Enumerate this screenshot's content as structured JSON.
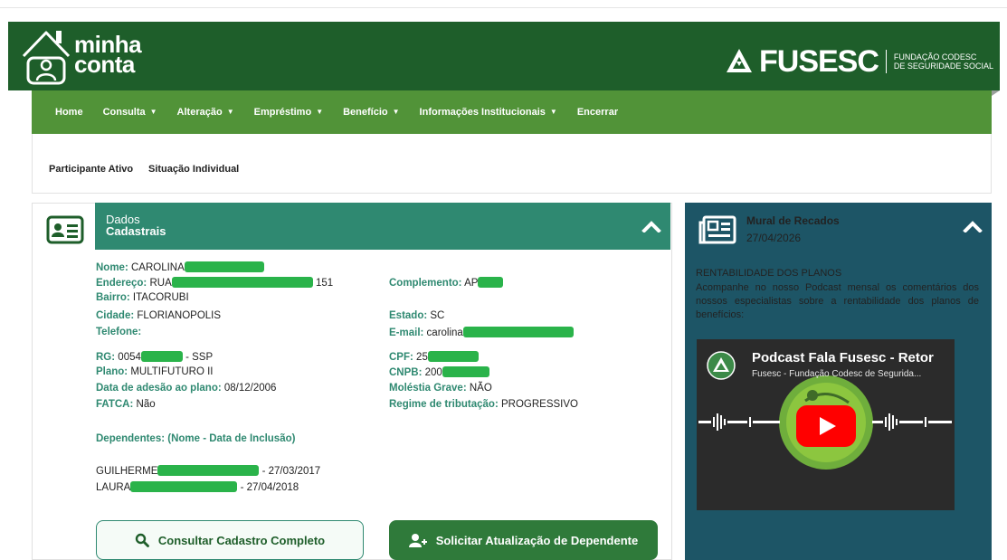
{
  "header": {
    "logo_line1": "minha",
    "logo_line2": "conta",
    "brand_name": "FUSESC",
    "brand_sub1": "FUNDAÇÃO CODESC",
    "brand_sub2": "DE SEGURIDADE SOCIAL"
  },
  "nav": {
    "items": [
      {
        "label": "Home",
        "dropdown": false
      },
      {
        "label": "Consulta",
        "dropdown": true
      },
      {
        "label": "Alteração",
        "dropdown": true
      },
      {
        "label": "Empréstimo",
        "dropdown": true
      },
      {
        "label": "Benefício",
        "dropdown": true
      },
      {
        "label": "Informações Institucionais",
        "dropdown": true
      },
      {
        "label": "Encerrar",
        "dropdown": false
      }
    ],
    "caret": "▼"
  },
  "subnav": {
    "status": "Participante Ativo",
    "situacao": "Situação Individual"
  },
  "dados": {
    "title1": "Dados",
    "title2": "Cadastrais",
    "nome_lbl": "Nome:",
    "nome_val": "CAROLINA",
    "endereco_lbl": "Endereço:",
    "endereco_val": "RUA",
    "endereco_num": "151",
    "complemento_lbl": "Complemento:",
    "complemento_val": "AP",
    "bairro_lbl": "Bairro:",
    "bairro_val": "ITACORUBI",
    "cidade_lbl": "Cidade:",
    "cidade_val": "FLORIANOPOLIS",
    "estado_lbl": "Estado:",
    "estado_val": "SC",
    "telefone_lbl": "Telefone:",
    "email_lbl": "E-mail:",
    "email_val": "carolina",
    "rg_lbl": "RG:",
    "rg_val": "0054",
    "rg_suffix": "- SSP",
    "cpf_lbl": "CPF:",
    "cpf_val": "25",
    "plano_lbl": "Plano:",
    "plano_val": "MULTIFUTURO II",
    "cnpb_lbl": "CNPB:",
    "cnpb_val": "200",
    "adesao_lbl": "Data de adesão ao plano:",
    "adesao_val": "08/12/2006",
    "molestia_lbl": "Moléstia Grave:",
    "molestia_val": "NÃO",
    "fatca_lbl": "FATCA:",
    "fatca_val": "Não",
    "regime_lbl": "Regime de tributação:",
    "regime_val": "PROGRESSIVO",
    "dependentes_lbl": "Dependentes: (Nome - Data de Inclusão)",
    "dependentes": [
      {
        "name": "GUILHERME",
        "date": "- 27/03/2017"
      },
      {
        "name": "LAURA",
        "date": "- 27/04/2018"
      }
    ],
    "btn_consultar": "Consultar Cadastro Completo",
    "btn_solicitar": "Solicitar Atualização de Dependente"
  },
  "mural": {
    "title": "Mural de Recados",
    "date": "27/04/2026",
    "heading": "RENTABILIDADE DOS PLANOS",
    "text": "Acompanhe no nosso Podcast mensal os comentários dos nossos especialistas sobre a rentabilidade dos planos de benefícios:",
    "video_title": "Podcast Fala Fusesc - Retor",
    "video_channel": "Fusesc - Fundação Codesc de Segurida..."
  },
  "colors": {
    "header_bg": "#1e5e2a",
    "nav_bg": "#519338",
    "panel_teal": "#2f8971",
    "mural_bg": "#1d5566",
    "mask_green": "#2ab34a",
    "youtube_red": "#ff0000"
  }
}
